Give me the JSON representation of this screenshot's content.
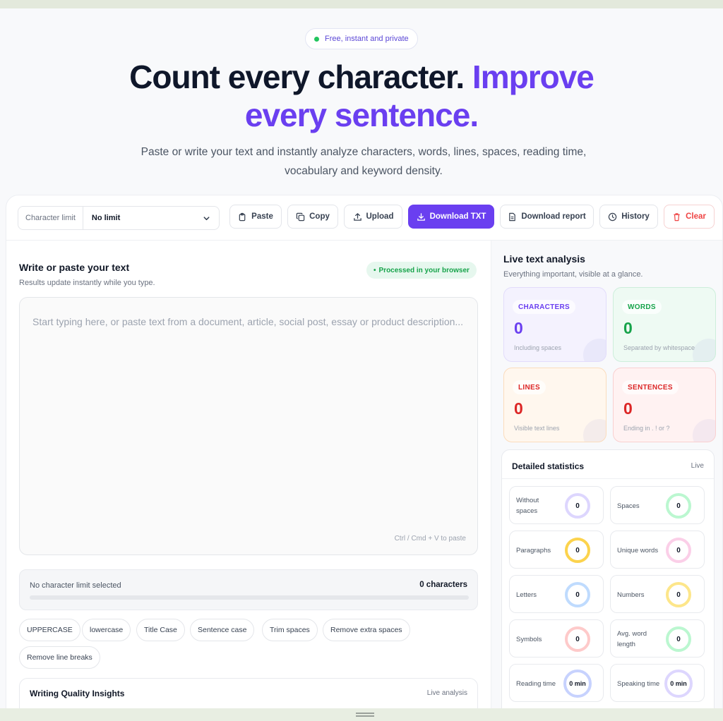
{
  "badge": {
    "text": "Free, instant and private"
  },
  "hero": {
    "title_plain": "Count every character. ",
    "title_accent_1": "Improve",
    "title_accent_2": "every sentence.",
    "subtitle": "Paste or write your text and instantly analyze characters, words, lines, spaces, reading time, vocabulary and keyword density."
  },
  "toolbar": {
    "char_limit_label": "Character limit",
    "char_limit_value": "No limit",
    "paste": "Paste",
    "copy": "Copy",
    "upload": "Upload",
    "download_txt": "Download TXT",
    "download_report": "Download report",
    "history": "History",
    "clear": "Clear"
  },
  "editor": {
    "title": "Write or paste your text",
    "subtitle": "Results update instantly while you type.",
    "processed_badge": "Processed in your browser",
    "placeholder": "Start typing here, or paste text from a document, article, social post, essay or product description...",
    "paste_hint": "Ctrl / Cmd + V to paste"
  },
  "limit": {
    "status": "No character limit selected",
    "count": "0 characters",
    "progress_percent": 0
  },
  "transforms": [
    "UPPERCASE",
    "lowercase",
    "Title Case",
    "Sentence case",
    "Trim spaces",
    "Remove extra spaces",
    "Remove line breaks"
  ],
  "insights": {
    "title": "Writing Quality Insights",
    "meta": "Live analysis"
  },
  "analysis": {
    "title": "Live text analysis",
    "subtitle": "Everything important, visible at a glance.",
    "cards": [
      {
        "label": "CHARACTERS",
        "value": "0",
        "caption": "Including spaces"
      },
      {
        "label": "WORDS",
        "value": "0",
        "caption": "Separated by whitespace"
      },
      {
        "label": "LINES",
        "value": "0",
        "caption": "Visible text lines"
      },
      {
        "label": "SENTENCES",
        "value": "0",
        "caption": "Ending in . ! or ?"
      }
    ]
  },
  "detailed": {
    "title": "Detailed statistics",
    "live": "Live",
    "items": [
      {
        "label": "Without spaces",
        "value": "0",
        "color": "#ddd6fe"
      },
      {
        "label": "Spaces",
        "value": "0",
        "color": "#bbf7d0"
      },
      {
        "label": "Paragraphs",
        "value": "0",
        "color": "#fcd34d"
      },
      {
        "label": "Unique words",
        "value": "0",
        "color": "#fbcfe8"
      },
      {
        "label": "Letters",
        "value": "0",
        "color": "#bfdbfe"
      },
      {
        "label": "Numbers",
        "value": "0",
        "color": "#fde68a"
      },
      {
        "label": "Symbols",
        "value": "0",
        "color": "#fecaca"
      },
      {
        "label": "Avg. word length",
        "value": "0",
        "color": "#bbf7d0"
      },
      {
        "label": "Reading time",
        "value": "0 min",
        "color": "#c7d2fe"
      },
      {
        "label": "Speaking time",
        "value": "0 min",
        "color": "#ddd6fe"
      }
    ]
  },
  "colors": {
    "accent": "#6a3ff0",
    "characters": "#6a3ff0",
    "words": "#16a34a",
    "lines": "#ea580c",
    "sentences": "#dc2626",
    "danger": "#ef4444"
  }
}
